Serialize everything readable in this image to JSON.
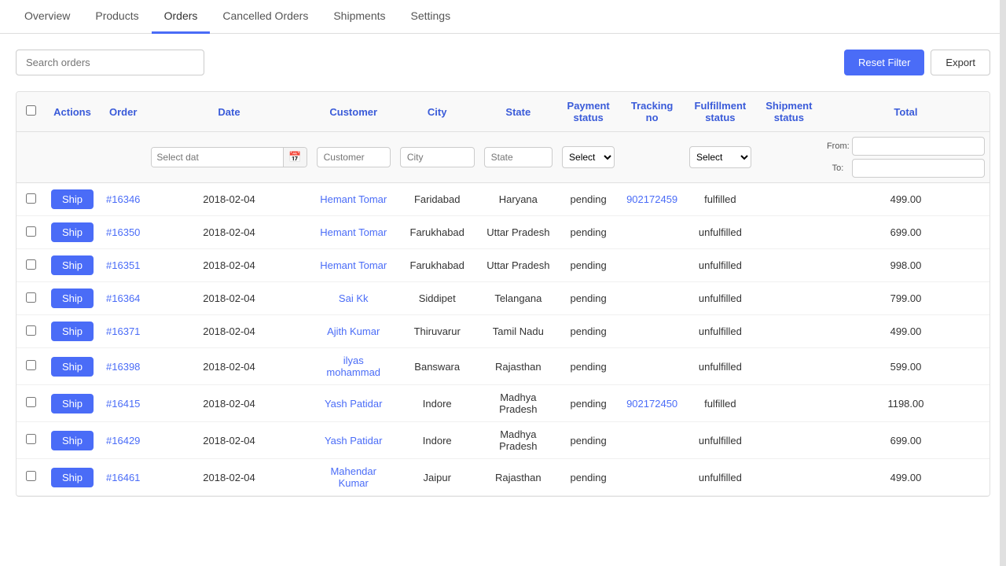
{
  "tabs": [
    {
      "id": "overview",
      "label": "Overview",
      "active": false
    },
    {
      "id": "products",
      "label": "Products",
      "active": false
    },
    {
      "id": "orders",
      "label": "Orders",
      "active": true
    },
    {
      "id": "cancelled-orders",
      "label": "Cancelled Orders",
      "active": false
    },
    {
      "id": "shipments",
      "label": "Shipments",
      "active": false
    },
    {
      "id": "settings",
      "label": "Settings",
      "active": false
    }
  ],
  "search": {
    "placeholder": "Search orders"
  },
  "toolbar": {
    "reset_filter": "Reset Filter",
    "export": "Export"
  },
  "table": {
    "columns": [
      {
        "id": "actions",
        "label": "Actions"
      },
      {
        "id": "order",
        "label": "Order"
      },
      {
        "id": "date",
        "label": "Date"
      },
      {
        "id": "customer",
        "label": "Customer"
      },
      {
        "id": "city",
        "label": "City"
      },
      {
        "id": "state",
        "label": "State"
      },
      {
        "id": "payment_status",
        "label": "Payment status"
      },
      {
        "id": "tracking_no",
        "label": "Tracking no"
      },
      {
        "id": "fulfillment_status",
        "label": "Fulfillment status"
      },
      {
        "id": "shipment_status",
        "label": "Shipment status"
      },
      {
        "id": "total",
        "label": "Total"
      }
    ],
    "filter_placeholders": {
      "date": "Select dat",
      "customer": "Customer",
      "city": "City",
      "state": "State",
      "payment_select": "Select",
      "fulfillment_select": "Select",
      "total_from": "From:",
      "total_to": "To:"
    },
    "rows": [
      {
        "order": "#16346",
        "date": "2018-02-04",
        "customer": "Hemant Tomar",
        "city": "Faridabad",
        "state": "Haryana",
        "payment_status": "pending",
        "tracking_no": "902172459",
        "fulfillment_status": "fulfilled",
        "shipment_status": "",
        "total": "499.00"
      },
      {
        "order": "#16350",
        "date": "2018-02-04",
        "customer": "Hemant Tomar",
        "city": "Farukhabad",
        "state": "Uttar Pradesh",
        "payment_status": "pending",
        "tracking_no": "",
        "fulfillment_status": "unfulfilled",
        "shipment_status": "",
        "total": "699.00"
      },
      {
        "order": "#16351",
        "date": "2018-02-04",
        "customer": "Hemant Tomar",
        "city": "Farukhabad",
        "state": "Uttar Pradesh",
        "payment_status": "pending",
        "tracking_no": "",
        "fulfillment_status": "unfulfilled",
        "shipment_status": "",
        "total": "998.00"
      },
      {
        "order": "#16364",
        "date": "2018-02-04",
        "customer": "Sai Kk",
        "city": "Siddipet",
        "state": "Telangana",
        "payment_status": "pending",
        "tracking_no": "",
        "fulfillment_status": "unfulfilled",
        "shipment_status": "",
        "total": "799.00"
      },
      {
        "order": "#16371",
        "date": "2018-02-04",
        "customer": "Ajith Kumar",
        "city": "Thiruvarur",
        "state": "Tamil Nadu",
        "payment_status": "pending",
        "tracking_no": "",
        "fulfillment_status": "unfulfilled",
        "shipment_status": "",
        "total": "499.00"
      },
      {
        "order": "#16398",
        "date": "2018-02-04",
        "customer": "ilyas mohammad",
        "city": "Banswara",
        "state": "Rajasthan",
        "payment_status": "pending",
        "tracking_no": "",
        "fulfillment_status": "unfulfilled",
        "shipment_status": "",
        "total": "599.00"
      },
      {
        "order": "#16415",
        "date": "2018-02-04",
        "customer": "Yash Patidar",
        "city": "Indore",
        "state": "Madhya Pradesh",
        "payment_status": "pending",
        "tracking_no": "902172450",
        "fulfillment_status": "fulfilled",
        "shipment_status": "",
        "total": "1198.00"
      },
      {
        "order": "#16429",
        "date": "2018-02-04",
        "customer": "Yash Patidar",
        "city": "Indore",
        "state": "Madhya Pradesh",
        "payment_status": "pending",
        "tracking_no": "",
        "fulfillment_status": "unfulfilled",
        "shipment_status": "",
        "total": "699.00"
      },
      {
        "order": "#16461",
        "date": "2018-02-04",
        "customer": "Mahendar Kumar",
        "city": "Jaipur",
        "state": "Rajasthan",
        "payment_status": "pending",
        "tracking_no": "",
        "fulfillment_status": "unfulfilled",
        "shipment_status": "",
        "total": "499.00"
      }
    ],
    "ship_label": "Ship"
  }
}
